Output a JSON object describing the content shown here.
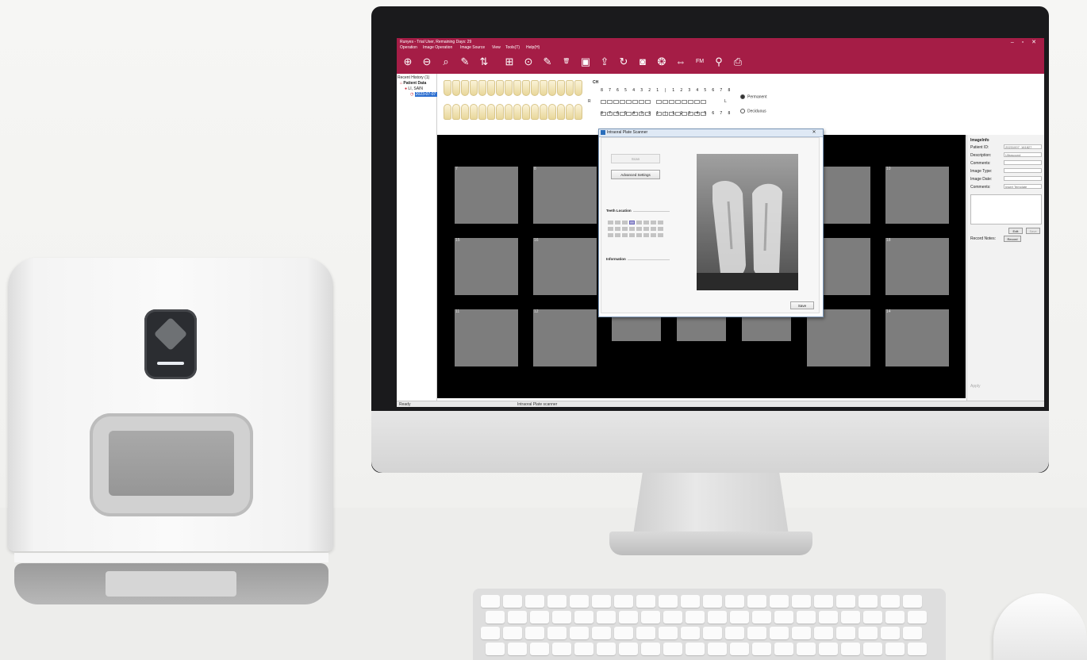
{
  "window": {
    "title": "Runyes - Trial User, Remaining Days: 29",
    "controls": "–  ▫  ✕"
  },
  "menu": [
    "Operation",
    "Image Operation",
    "Image Source",
    "View",
    "Tools(T)",
    "Help(H)"
  ],
  "toolbar": {
    "icons": [
      "zoom-in-icon",
      "zoom-out-icon",
      "magnifier-icon",
      "pen-icon",
      "sort-icon",
      "grid-icon",
      "play-icon",
      "edit-icon",
      "delete-icon",
      "image-import-icon",
      "export-icon",
      "refresh-icon",
      "camera-icon",
      "capture-icon",
      "flip-icon",
      "fm-icon",
      "tooth-tool-icon",
      "print-icon"
    ],
    "glyphs": [
      "⊕",
      "⊖",
      "⌕",
      "✎",
      "⇅",
      "⊞",
      "⊙",
      "✎",
      "🗑",
      "▣",
      "⇪",
      "↻",
      "◙",
      "❂",
      "⇔",
      "FM",
      "⚲",
      "⎙"
    ]
  },
  "tree": {
    "header": "Recent History (1)",
    "root": "Patient Data",
    "patient": "LI, SAIN",
    "exam": "2023-07-07 1623"
  },
  "teeth": {
    "chart_label": "CH",
    "upper_numbers": "8 7 6 5 4 3 2 1 | 1 2 3 4 5 6 7 8",
    "lower_numbers": "8 7 6 5 4 3 2 1 | 1 2 3 4 5 6 7 8",
    "side_right": "R",
    "side_left": "L",
    "dentition": [
      {
        "label": "Permanent",
        "checked": true
      },
      {
        "label": "Deciduous",
        "checked": false
      }
    ]
  },
  "image_slots": {
    "top": [
      "7",
      "8",
      "",
      "",
      "",
      "9",
      "10"
    ],
    "middle": [
      "15",
      "16",
      "",
      "",
      "",
      "17",
      "18"
    ],
    "bottom": [
      "11",
      "12",
      "",
      "",
      "",
      "13",
      "14"
    ]
  },
  "info": {
    "title": "ImageInfo",
    "fields": [
      {
        "label": "Patient ID:",
        "value": "20231007_161827"
      },
      {
        "label": "Description:",
        "value": "Ultrasound"
      },
      {
        "label": "Comments:",
        "value": ""
      },
      {
        "label": "Image Type:",
        "value": ""
      },
      {
        "label": "Image Date:",
        "value": ""
      },
      {
        "label": "Comments:",
        "value": "Insert Template"
      }
    ],
    "edit": "Edit",
    "save": "Save",
    "record_label": "Record Notes:",
    "record_button": "Record",
    "bottom": "Apply"
  },
  "dialog": {
    "title": "Intraoral Plate Scanner",
    "close": "✕",
    "scan_button": "Scan",
    "advanced_button": "Advanced Settings",
    "teeth_group": "Teeth Location",
    "info_group": "Information",
    "save_button": "Save"
  },
  "status": {
    "left": "Ready",
    "center": "Intraoral Plate scanner"
  },
  "colors": {
    "accent": "#a51d46",
    "selection": "#2d6fd0"
  }
}
